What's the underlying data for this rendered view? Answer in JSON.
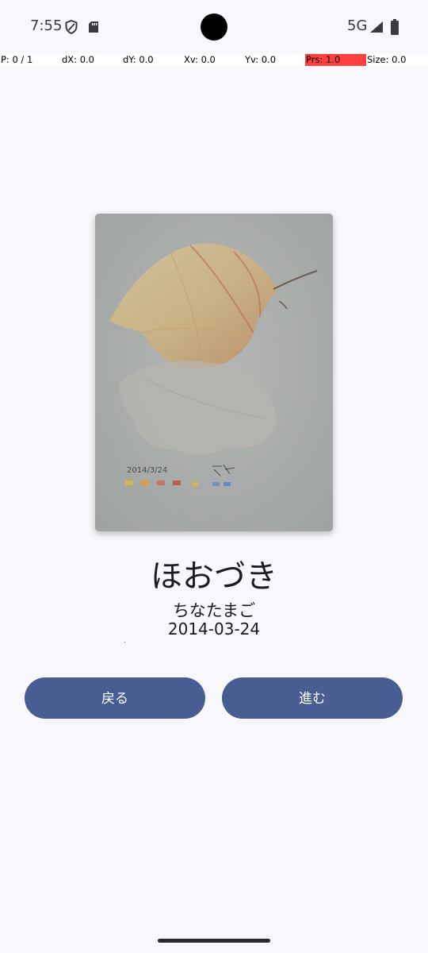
{
  "status_bar": {
    "time": "7:55",
    "network": "5G",
    "icons": [
      "shield-icon",
      "sd-card-icon",
      "signal-icon",
      "battery-icon"
    ]
  },
  "pointer_overlay": {
    "p": "P: 0 / 1",
    "dx": "dX: 0.0",
    "dy": "dY: 0.0",
    "xv": "Xv: 0.0",
    "yv": "Yv: 0.0",
    "prs": "Prs: 1.0",
    "size": "Size: 0.0",
    "prs_highlight_color": "#ff4040"
  },
  "artwork": {
    "title": "ほおづき",
    "artist": "ちなたまご",
    "date": "2014-03-24",
    "signature": "2014/3/24"
  },
  "buttons": {
    "back_label": "戻る",
    "next_label": "進む",
    "color": "#485d92"
  },
  "colors": {
    "background": "#f8f7fc",
    "button": "#485d92"
  }
}
